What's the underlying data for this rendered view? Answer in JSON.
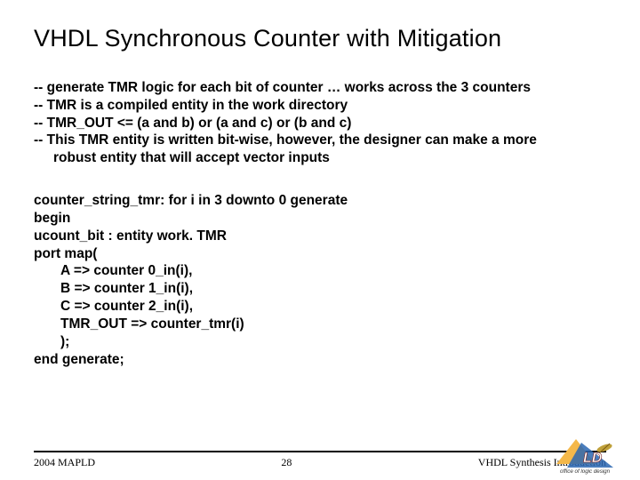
{
  "title": "VHDL Synchronous Counter with Mitigation",
  "comments": {
    "l1": "-- generate TMR logic for each bit of counter … works across the 3 counters",
    "l2": "-- TMR is a compiled entity in the work directory",
    "l3": "-- TMR_OUT <= (a and b) or (a and c) or (b and c)",
    "l4": "-- This TMR entity is written bit-wise, however, the designer can make a more",
    "l4b": "robust entity that will accept vector inputs"
  },
  "code": {
    "l1": "counter_string_tmr: for i in 3 downto 0 generate",
    "l2": "begin",
    "l3": "ucount_bit               : entity work. TMR",
    "l4": "port map(",
    "l5": "A        => counter 0_in(i),",
    "l6": "B        => counter 1_in(i),",
    "l7": "C        => counter 2_in(i),",
    "l8": "TMR_OUT      => counter_tmr(i)",
    "l9": ");",
    "l10": "end generate;"
  },
  "footer": {
    "left": "2004 MAPLD",
    "center": "28",
    "right": "VHDL Synthesis Introduction"
  },
  "logo": {
    "upper": "LD",
    "lower": "office of logic design"
  }
}
